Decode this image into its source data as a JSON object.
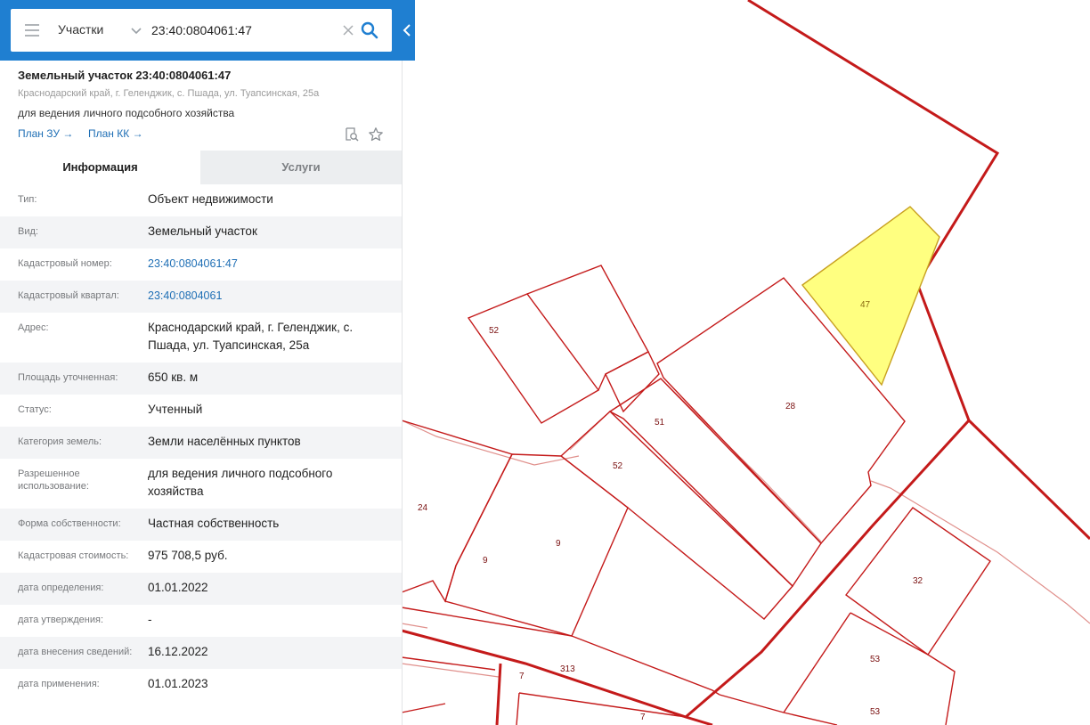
{
  "search": {
    "type_label": "Участки",
    "query": "23:40:0804061:47"
  },
  "object": {
    "title": "Земельный участок 23:40:0804061:47",
    "address": "Краснодарский край, г. Геленджик, с. Пшада, ул. Туапсинская, 25а",
    "use": "для ведения личного подсобного хозяйства",
    "links": {
      "plan_zu": "План ЗУ →",
      "plan_kk": "План КК →"
    }
  },
  "tabs": [
    {
      "label": "Информация",
      "active": true
    },
    {
      "label": "Услуги",
      "active": false
    }
  ],
  "info": [
    {
      "label": "Тип:",
      "value": "Объект недвижимости"
    },
    {
      "label": "Вид:",
      "value": "Земельный участок"
    },
    {
      "label": "Кадастровый номер:",
      "value": "23:40:0804061:47",
      "link": true
    },
    {
      "label": "Кадастровый квартал:",
      "value": "23:40:0804061",
      "link": true
    },
    {
      "label": "Адрес:",
      "value": "Краснодарский край, г. Геленджик, с. Пшада, ул. Туапсинская, 25а"
    },
    {
      "label": "Площадь уточненная:",
      "value": "650 кв. м"
    },
    {
      "label": "Статус:",
      "value": "Учтенный"
    },
    {
      "label": "Категория земель:",
      "value": "Земли населённых пунктов"
    },
    {
      "label": "Разрешенное использование:",
      "value": "для ведения личного подсобного хозяйства"
    },
    {
      "label": "Форма собственности:",
      "value": "Частная собственность"
    },
    {
      "label": "Кадастровая стоимость:",
      "value": "975 708,5 руб."
    },
    {
      "label": "дата определения:",
      "value": "01.01.2022"
    },
    {
      "label": "дата утверждения:",
      "value": "-"
    },
    {
      "label": "дата внесения сведений:",
      "value": "16.12.2022"
    },
    {
      "label": "дата применения:",
      "value": "01.01.2023"
    }
  ],
  "map": {
    "parcel_labels": [
      "47",
      "52",
      "28",
      "51",
      "52",
      "24",
      "9",
      "9",
      "32",
      "313",
      "7",
      "53",
      "53",
      "7"
    ],
    "selected_parcel": "47"
  },
  "colors": {
    "header_blue": "#1f7fd1",
    "parcel_border": "#c41a1a",
    "selected_fill": "#ffff80",
    "link_blue": "#1f6fb5"
  }
}
